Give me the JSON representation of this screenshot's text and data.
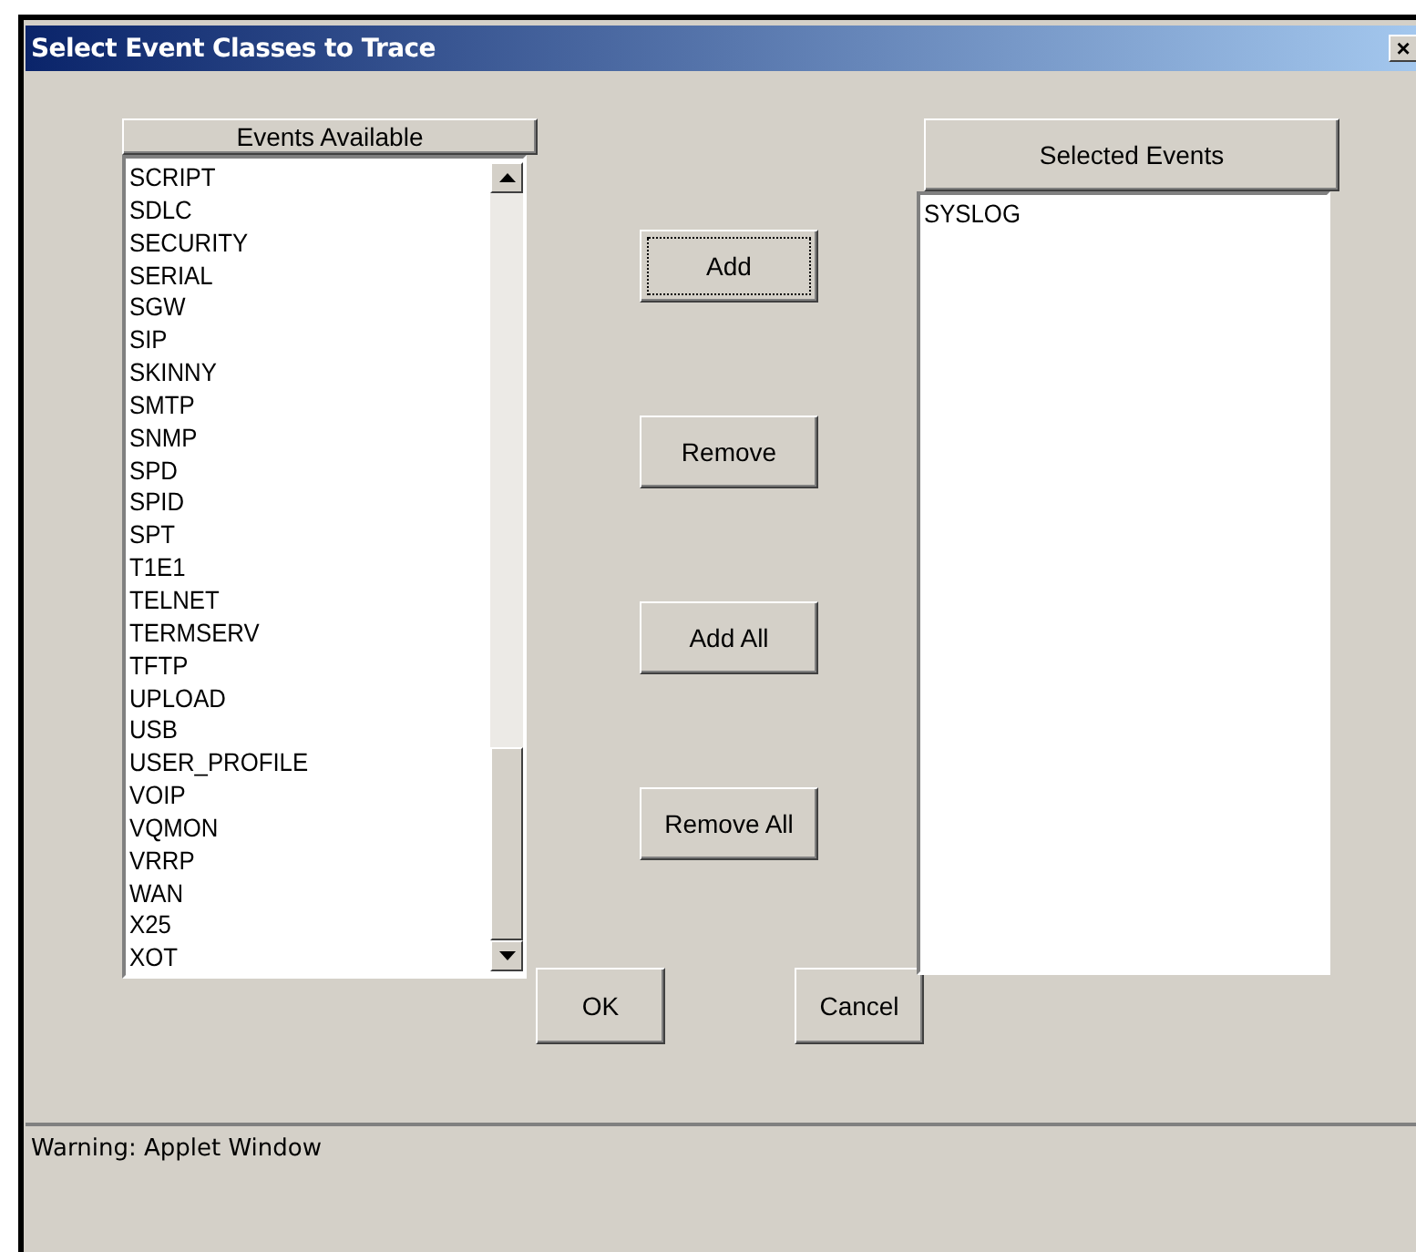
{
  "window": {
    "title": "Select Event Classes to Trace",
    "close_label": "×"
  },
  "available": {
    "header": "Events Available",
    "items": [
      "SCRIPT",
      "SDLC",
      "SECURITY",
      "SERIAL",
      "SGW",
      "SIP",
      "SKINNY",
      "SMTP",
      "SNMP",
      "SPD",
      "SPID",
      "SPT",
      "T1E1",
      "TELNET",
      "TERMSERV",
      "TFTP",
      "UPLOAD",
      "USB",
      "USER_PROFILE",
      "VOIP",
      "VQMON",
      "VRRP",
      "WAN",
      "X25",
      "XOT"
    ]
  },
  "selected": {
    "header": "Selected Events",
    "items": [
      "SYSLOG"
    ]
  },
  "actions": [
    {
      "label": "Add",
      "focused": true
    },
    {
      "label": "Remove",
      "focused": false
    },
    {
      "label": "Add All",
      "focused": false
    },
    {
      "label": "Remove All",
      "focused": false
    }
  ],
  "buttons": [
    {
      "label": "OK"
    },
    {
      "label": "Cancel"
    }
  ],
  "status_bar": "Warning: Applet Window"
}
